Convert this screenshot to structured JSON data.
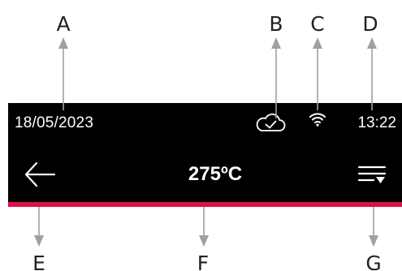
{
  "callouts": {
    "a": "A",
    "b": "B",
    "c": "C",
    "d": "D",
    "e": "E",
    "f": "F",
    "g": "G"
  },
  "status_bar": {
    "date": "18/05/2023",
    "time": "13:22",
    "cloud_icon": "cloud-check-icon",
    "wifi_icon": "wifi-icon"
  },
  "header": {
    "temperature": "275ºC",
    "back_icon": "arrow-left-icon",
    "filter_icon": "filter-menu-icon"
  },
  "colors": {
    "bar_background": "#000000",
    "accent": "#e0114a",
    "text": "#ffffff",
    "callout": "#a0a0a0"
  }
}
